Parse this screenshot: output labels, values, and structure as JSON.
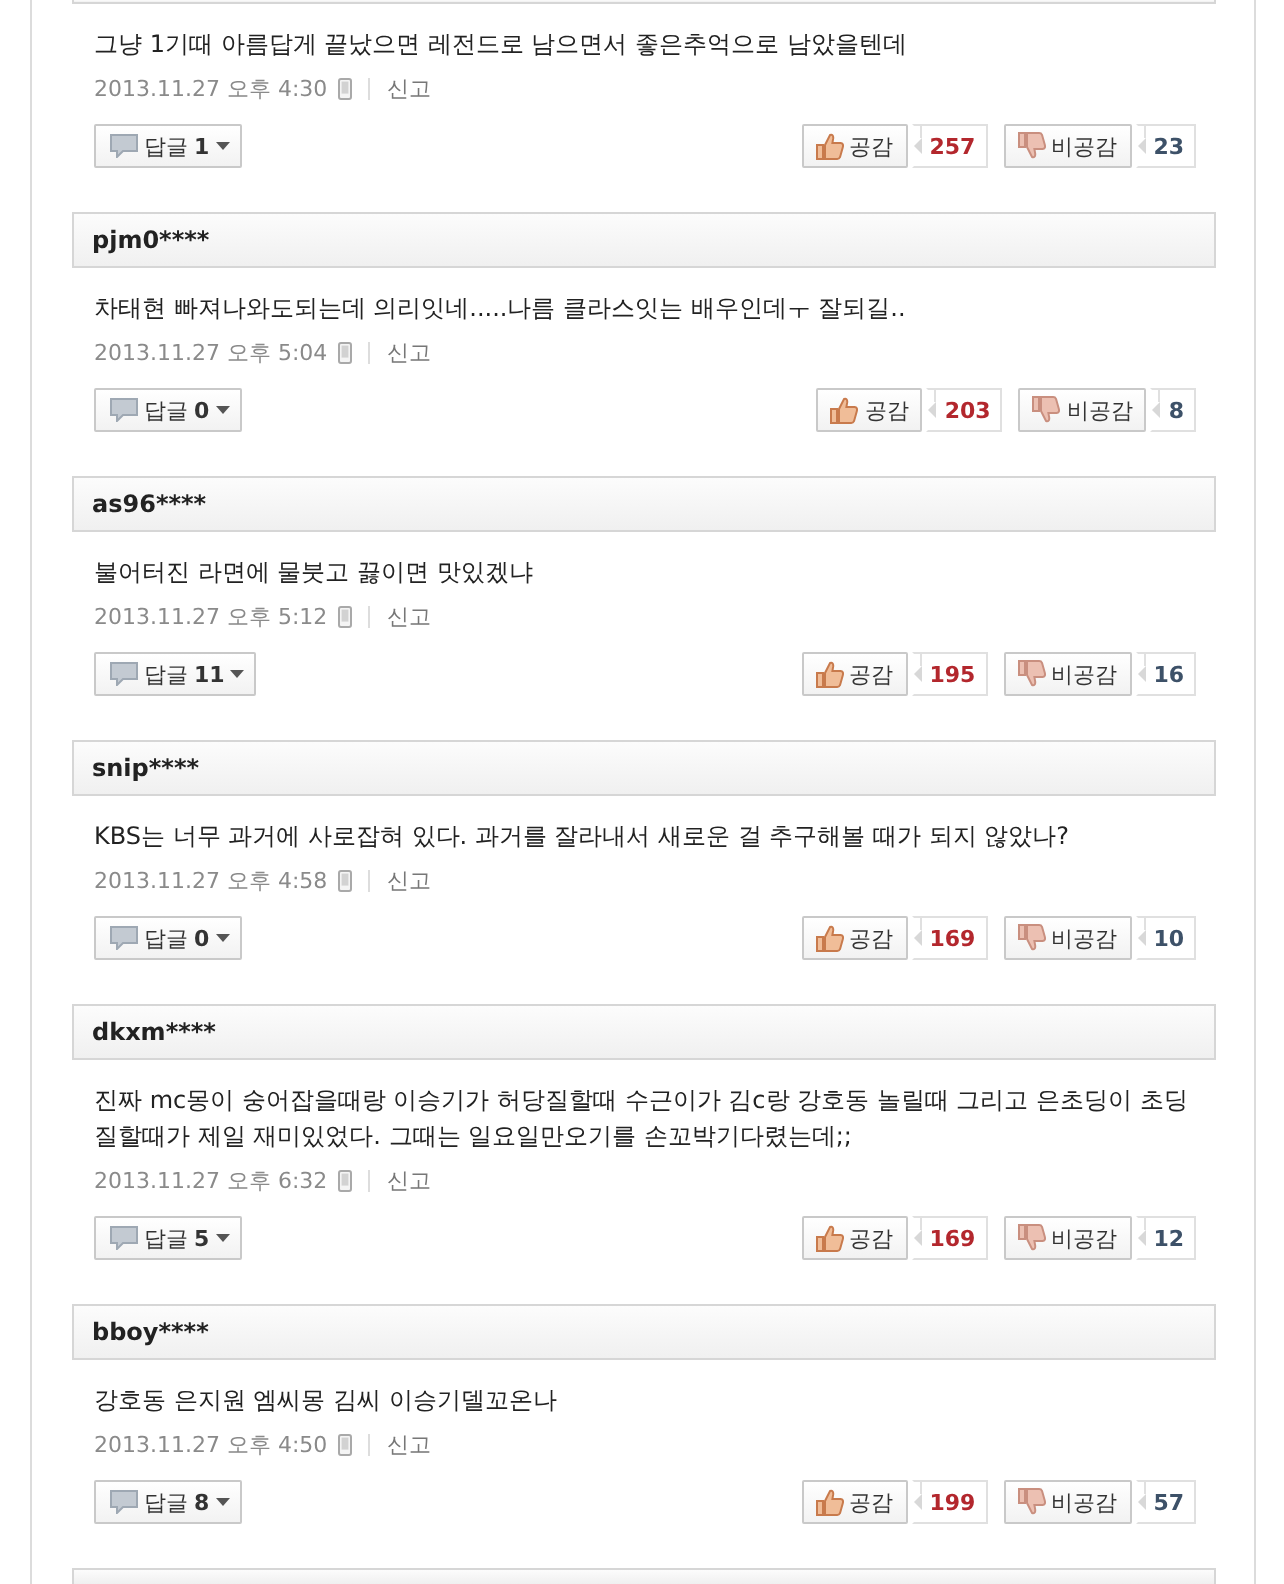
{
  "comments": [
    {
      "text": "그냥 1기때 아름답게 끝났으면 레전드로 남으면서 좋은추억으로 남았을텐데",
      "date": "2013.11.27 오후 4:30",
      "report": "신고",
      "reply_label": "답글",
      "reply_count": "1",
      "like_label": "공감",
      "likes": "257",
      "dislike_label": "비공감",
      "dislikes": "23"
    },
    {
      "author": "pjm0****",
      "text": "차태현 빠져나와도되는데 의리잇네.....나름 클라스잇는 배우인데ㅜ 잘되길..",
      "date": "2013.11.27 오후 5:04",
      "report": "신고",
      "reply_label": "답글",
      "reply_count": "0",
      "like_label": "공감",
      "likes": "203",
      "dislike_label": "비공감",
      "dislikes": "8"
    },
    {
      "author": "as96****",
      "text": "불어터진 라면에 물붓고 끓이면 맛있겠냐",
      "date": "2013.11.27 오후 5:12",
      "report": "신고",
      "reply_label": "답글",
      "reply_count": "11",
      "like_label": "공감",
      "likes": "195",
      "dislike_label": "비공감",
      "dislikes": "16"
    },
    {
      "author": "snip****",
      "text": "KBS는 너무 과거에 사로잡혀 있다. 과거를 잘라내서 새로운 걸 추구해볼 때가 되지 않았나?",
      "date": "2013.11.27 오후 4:58",
      "report": "신고",
      "reply_label": "답글",
      "reply_count": "0",
      "like_label": "공감",
      "likes": "169",
      "dislike_label": "비공감",
      "dislikes": "10"
    },
    {
      "author": "dkxm****",
      "text": "진짜 mc몽이 숭어잡을때랑 이승기가 허당질할때 수근이가 김c랑 강호동 놀릴때 그리고 은초딩이 초딩질할때가 제일 재미있었다. 그때는 일요일만오기를 손꼬박기다렸는데;;",
      "date": "2013.11.27 오후 6:32",
      "report": "신고",
      "reply_label": "답글",
      "reply_count": "5",
      "like_label": "공감",
      "likes": "169",
      "dislike_label": "비공감",
      "dislikes": "12"
    },
    {
      "author": "bboy****",
      "text": "강호동 은지원 엠씨몽 김씨 이승기델꼬온나",
      "date": "2013.11.27 오후 4:50",
      "report": "신고",
      "reply_label": "답글",
      "reply_count": "8",
      "like_label": "공감",
      "likes": "199",
      "dislike_label": "비공감",
      "dislikes": "57"
    }
  ]
}
